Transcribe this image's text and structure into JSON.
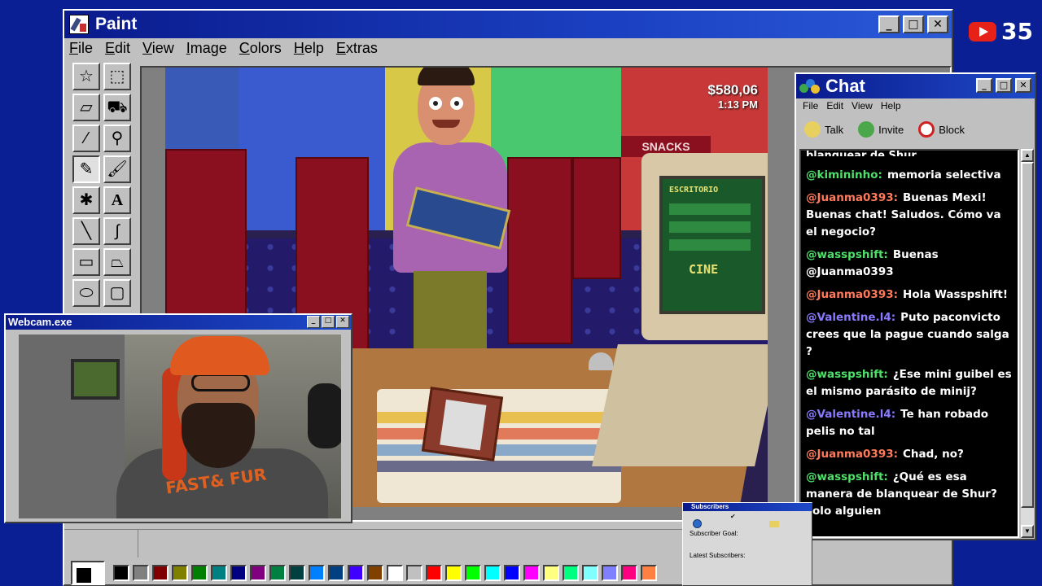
{
  "paint": {
    "title": "Paint",
    "menu": [
      "File",
      "Edit",
      "View",
      "Image",
      "Colors",
      "Help",
      "Extras"
    ],
    "tools": [
      "free-select-icon",
      "rect-select-icon",
      "eraser-icon",
      "fill-icon",
      "color-picker-icon",
      "magnifier-icon",
      "pencil-icon",
      "brush-icon",
      "airbrush-icon",
      "text-icon",
      "line-icon",
      "curve-icon",
      "rectangle-icon",
      "polygon-icon",
      "ellipse-icon",
      "rounded-rect-icon"
    ],
    "palette": [
      "#000000",
      "#808080",
      "#800000",
      "#808000",
      "#008000",
      "#008080",
      "#000080",
      "#800080",
      "#008040",
      "#004040",
      "#0080ff",
      "#004080",
      "#4000ff",
      "#804000",
      "#ffffff",
      "#c0c0c0",
      "#ff0000",
      "#ffff00",
      "#00ff00",
      "#00ffff",
      "#0000ff",
      "#ff00ff",
      "#ffff80",
      "#00ff80",
      "#80ffff",
      "#8080ff",
      "#ff0080",
      "#ff8040"
    ]
  },
  "game": {
    "money": "$580,06",
    "time": "1:13 PM",
    "sign": "SNACKS",
    "screen_header": "ESCRITORIO",
    "screen_title": "CINE"
  },
  "youtube": {
    "count": "35"
  },
  "chat": {
    "title": "Chat",
    "menu": [
      "File",
      "Edit",
      "View",
      "Help"
    ],
    "actions": {
      "talk": "Talk",
      "invite": "Invite",
      "block": "Block"
    },
    "cut_top": "blanquear de Shur",
    "messages": [
      {
        "user": "@kimininho:",
        "text": "memoria selectiva",
        "color": "#4fe06a"
      },
      {
        "user": "@Juanma0393:",
        "text": "Buenas Mexi! Buenas chat! Saludos. Cómo va el negocio?",
        "color": "#ff7a5a"
      },
      {
        "user": "@wasspshift:",
        "text": "Buenas @Juanma0393",
        "color": "#4fe06a"
      },
      {
        "user": "@Juanma0393:",
        "text": "Hola Wasspshift!",
        "color": "#ff7a5a"
      },
      {
        "user": "@Valentine.l4:",
        "text": "Puto paconvicto crees que la pague cuando salga ?",
        "color": "#8a7aff"
      },
      {
        "user": "@wasspshift:",
        "text": "¿Ese mini guibel es el mismo parásito de minij?",
        "color": "#4fe06a"
      },
      {
        "user": "@Valentine.l4:",
        "text": "Te han robado pelis no tal",
        "color": "#8a7aff"
      },
      {
        "user": "@Juanma0393:",
        "text": "Chad, no?",
        "color": "#ff7a5a"
      },
      {
        "user": "@wasspshift:",
        "text": "¿Qué es esa manera de blanquear de Shur? solo alguien",
        "color": "#4fe06a"
      }
    ]
  },
  "webcam": {
    "title": "Webcam.exe",
    "shirt_text": "FAST& FUR"
  },
  "subscribers": {
    "title": "Subscribers",
    "goal_label": "Subscriber Goal:",
    "latest_label": "Latest Subscribers:"
  }
}
